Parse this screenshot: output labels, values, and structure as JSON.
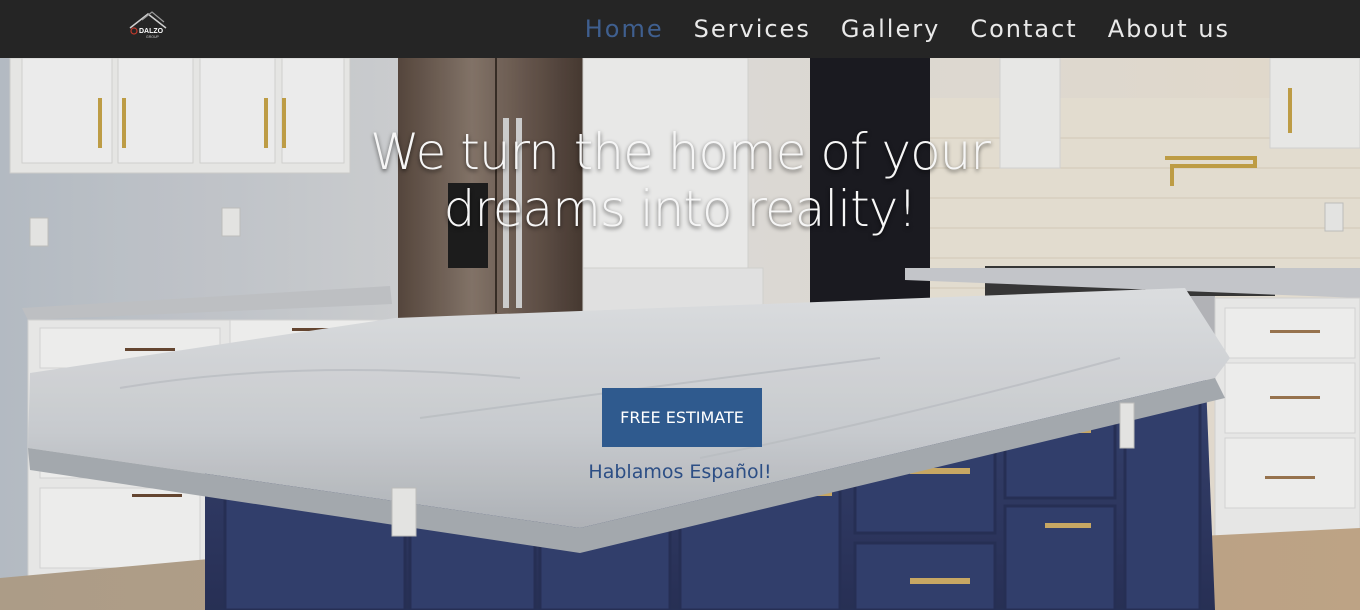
{
  "brand": {
    "logo_text": "DALZO",
    "logo_subtext": "GROUP"
  },
  "nav": {
    "items": [
      {
        "label": "Home",
        "active": true
      },
      {
        "label": "Services",
        "active": false
      },
      {
        "label": "Gallery",
        "active": false
      },
      {
        "label": "Contact",
        "active": false
      },
      {
        "label": "About us",
        "active": false
      }
    ]
  },
  "hero": {
    "headline": "We turn the home of your dreams into reality!",
    "cta_label": "FREE ESTIMATE",
    "subtext": "Hablamos Español!",
    "image_alt_icon": "kitchen-photo"
  },
  "colors": {
    "nav_bg": "#252525",
    "nav_text": "#e9e9e9",
    "nav_active": "#3f5f8f",
    "accent": "#2f5a8e",
    "subtext": "#2c4e85"
  }
}
